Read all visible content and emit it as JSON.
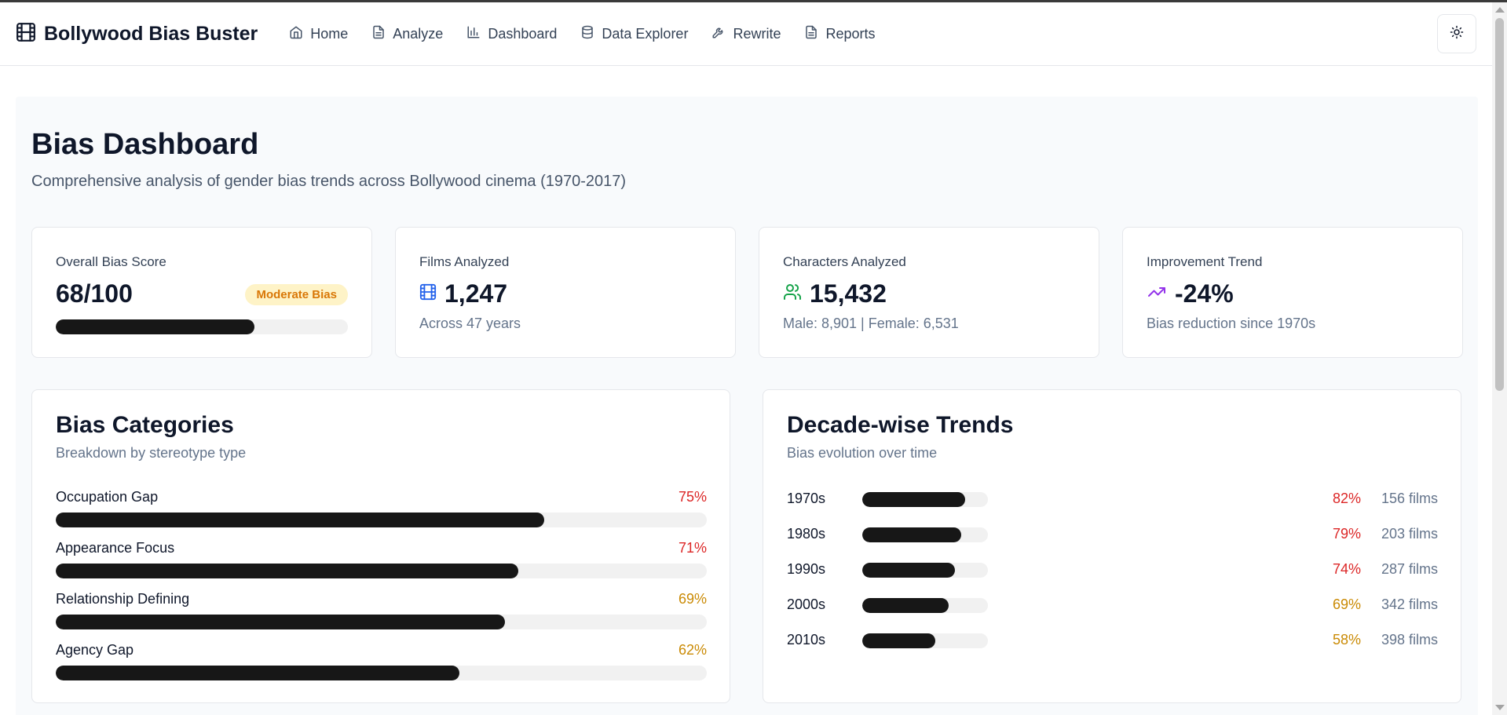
{
  "app": {
    "title": "Bollywood Bias Buster",
    "nav": [
      {
        "label": "Home",
        "icon": "home-icon"
      },
      {
        "label": "Analyze",
        "icon": "file-text-icon"
      },
      {
        "label": "Dashboard",
        "icon": "bar-chart-icon"
      },
      {
        "label": "Data Explorer",
        "icon": "database-icon"
      },
      {
        "label": "Rewrite",
        "icon": "wrench-icon"
      },
      {
        "label": "Reports",
        "icon": "file-text-icon"
      }
    ],
    "theme_toggle_icon": "sun-icon"
  },
  "page": {
    "title": "Bias Dashboard",
    "subtitle": "Comprehensive analysis of gender bias trends across Bollywood cinema (1970-2017)"
  },
  "stats": {
    "overall": {
      "label": "Overall Bias Score",
      "value": "68/100",
      "badge": "Moderate Bias",
      "progress": 0.68
    },
    "films": {
      "label": "Films Analyzed",
      "value": "1,247",
      "sub": "Across 47 years",
      "icon": "film-icon"
    },
    "characters": {
      "label": "Characters Analyzed",
      "value": "15,432",
      "sub": "Male: 8,901 | Female: 6,531",
      "icon": "users-icon"
    },
    "trend": {
      "label": "Improvement Trend",
      "value": "-24%",
      "sub": "Bias reduction since 1970s",
      "icon": "trending-up-icon"
    }
  },
  "categories": {
    "title": "Bias Categories",
    "subtitle": "Breakdown by stereotype type",
    "items": [
      {
        "label": "Occupation Gap",
        "pct": "75%",
        "value": 0.75,
        "color": "#dc2626"
      },
      {
        "label": "Appearance Focus",
        "pct": "71%",
        "value": 0.71,
        "color": "#dc2626"
      },
      {
        "label": "Relationship Defining",
        "pct": "69%",
        "value": 0.69,
        "color": "#ca8a04"
      },
      {
        "label": "Agency Gap",
        "pct": "62%",
        "value": 0.62,
        "color": "#ca8a04"
      }
    ]
  },
  "decades": {
    "title": "Decade-wise Trends",
    "subtitle": "Bias evolution over time",
    "items": [
      {
        "label": "1970s",
        "pct": "82%",
        "value": 0.82,
        "films": "156 films",
        "color": "#dc2626"
      },
      {
        "label": "1980s",
        "pct": "79%",
        "value": 0.79,
        "films": "203 films",
        "color": "#dc2626"
      },
      {
        "label": "1990s",
        "pct": "74%",
        "value": 0.74,
        "films": "287 films",
        "color": "#dc2626"
      },
      {
        "label": "2000s",
        "pct": "69%",
        "value": 0.69,
        "films": "342 films",
        "color": "#ca8a04"
      },
      {
        "label": "2010s",
        "pct": "58%",
        "value": 0.58,
        "films": "398 films",
        "color": "#ca8a04"
      }
    ]
  }
}
